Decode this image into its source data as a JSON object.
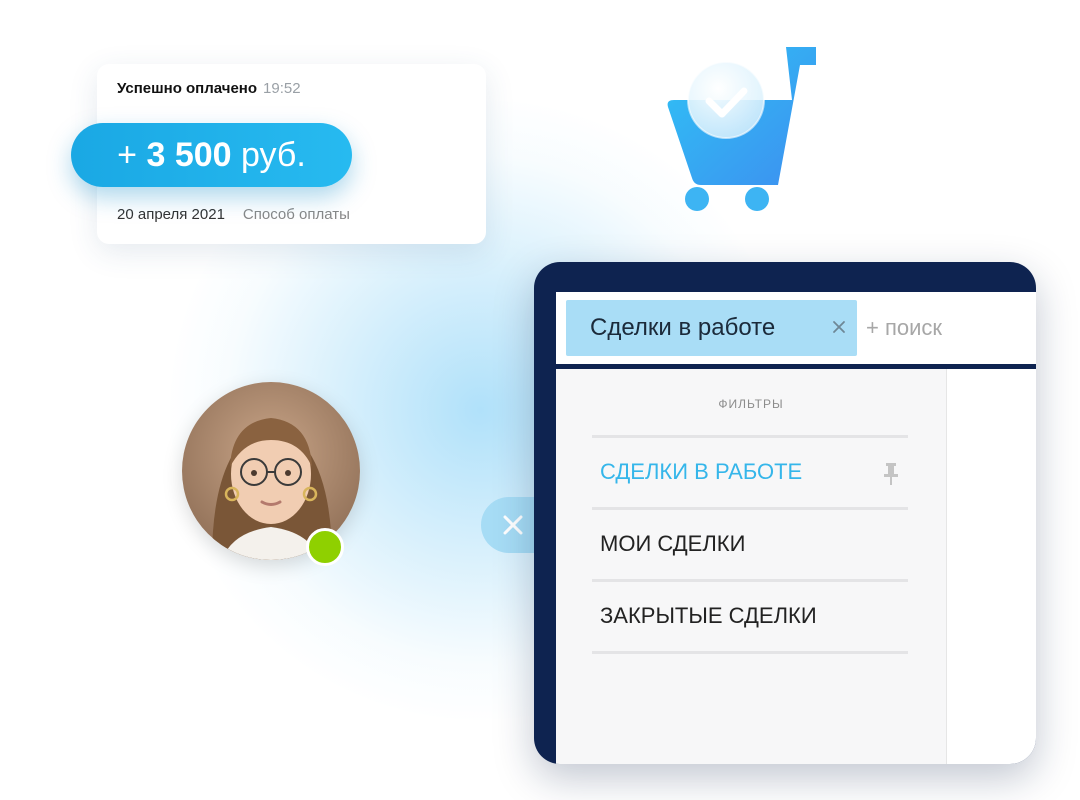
{
  "payment": {
    "status": "Успешно оплачено",
    "time": "19:52",
    "amount_prefix": "+ ",
    "amount_value": "3 500",
    "amount_currency": " руб.",
    "date": "20 апреля 2021",
    "method_label": "Способ оплаты"
  },
  "search": {
    "chip_label": "Сделки в работе",
    "placeholder": "+ поиск"
  },
  "filters": {
    "title": "ФИЛЬТРЫ",
    "items": [
      {
        "label": "СДЕЛКИ В РАБОТЕ"
      },
      {
        "label": "МОИ СДЕЛКИ"
      },
      {
        "label": "ЗАКРЫТЫЕ СДЕЛКИ"
      }
    ]
  },
  "colors": {
    "accent": "#27baf0",
    "online": "#8fd000",
    "window": "#0e2350",
    "chip": "#a9ddf6"
  },
  "icons": {
    "cart": "cart-check-icon",
    "close": "close-icon",
    "pin": "pin-icon",
    "online": "online-status-icon"
  }
}
